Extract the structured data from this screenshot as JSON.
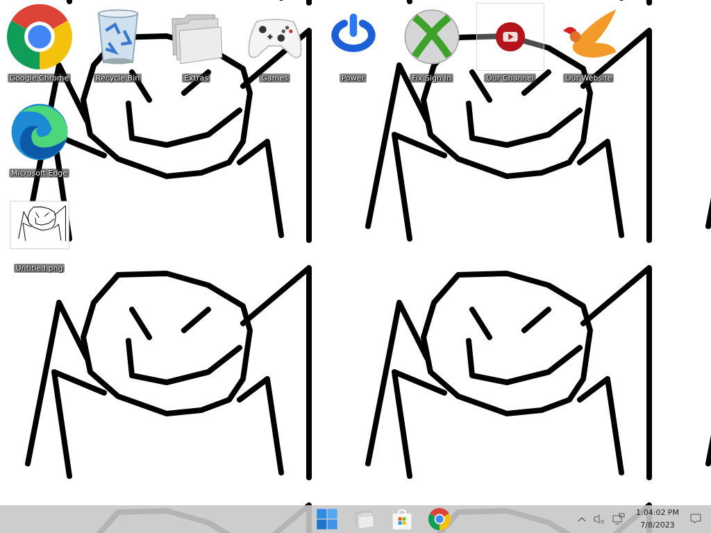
{
  "desktop": {
    "icon_rows": [
      [
        {
          "kind": "chrome",
          "label": "Google Chrome",
          "selected": false
        },
        {
          "kind": "recycle",
          "label": "Recycle Bin",
          "selected": false
        },
        {
          "kind": "folder",
          "label": "Extras",
          "selected": false
        },
        {
          "kind": "gamepad",
          "label": "Games",
          "selected": false
        },
        {
          "kind": "power",
          "label": "Power",
          "selected": false
        },
        {
          "kind": "xbox",
          "label": "Fix Sign In",
          "selected": false
        },
        {
          "kind": "video",
          "label": "Our Channel",
          "selected": true
        },
        {
          "kind": "bird",
          "label": "Our Website",
          "selected": false
        }
      ],
      [
        {
          "kind": "edge",
          "label": "Microsoft Edge",
          "selected": false
        }
      ],
      [
        {
          "kind": "image",
          "label": "Untitled.png",
          "selected": false
        }
      ]
    ]
  },
  "taskbar": {
    "apps": [
      {
        "kind": "start"
      },
      {
        "kind": "folder"
      },
      {
        "kind": "store"
      },
      {
        "kind": "chrome"
      }
    ],
    "tray": {
      "time": "1:04:02 PM",
      "date": "7/8/2023"
    }
  }
}
